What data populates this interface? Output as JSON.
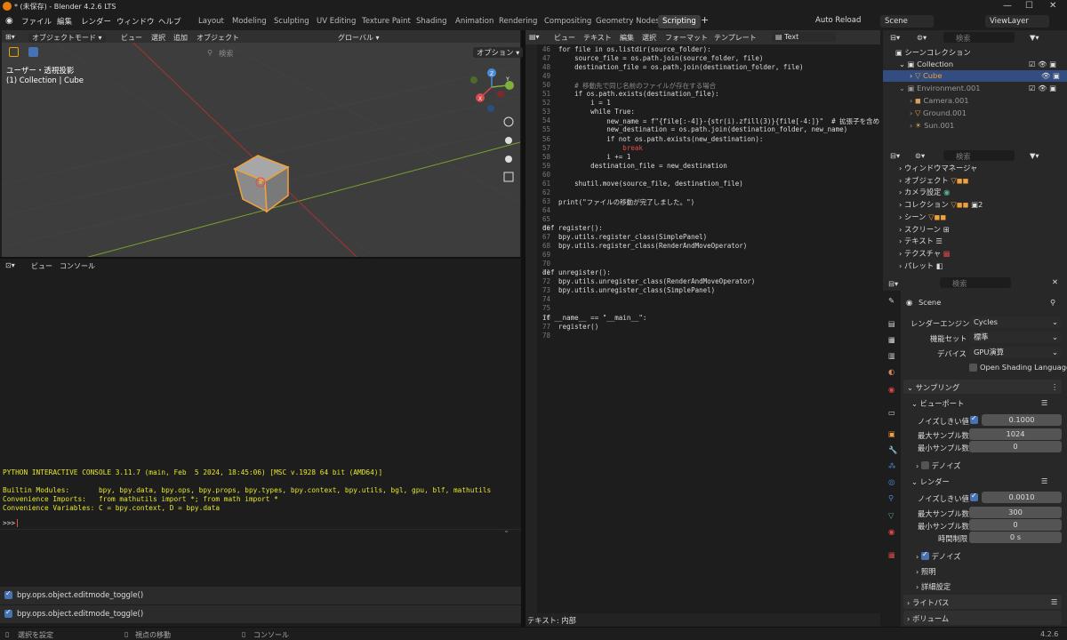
{
  "window": {
    "title": "* (未保存) - Blender 4.2.6 LTS"
  },
  "menus": [
    "ファイル",
    "編集",
    "レンダー",
    "ウィンドウ",
    "ヘルプ"
  ],
  "workspaces": [
    "Layout",
    "Modeling",
    "Sculpting",
    "UV Editing",
    "Texture Paint",
    "Shading",
    "Animation",
    "Rendering",
    "Compositing",
    "Geometry Nodes",
    "Scripting"
  ],
  "active_workspace": "Scripting",
  "top_right": {
    "auto_reload": "Auto Reload",
    "scene": "Scene",
    "view_layer": "ViewLayer"
  },
  "viewport": {
    "mode": "オブジェクトモード",
    "menu": [
      "ビュー",
      "選択",
      "追加",
      "オブジェクト"
    ],
    "orientation": "グローバル",
    "search_placeholder": "検索",
    "options": "オプション",
    "overlay_title": "ユーザー・透視投影",
    "overlay_sub": "(1) Collection | Cube",
    "gizmo": {
      "x": "X",
      "y": "Y",
      "z": "Z"
    }
  },
  "console": {
    "menu": [
      "ビュー",
      "コンソール"
    ],
    "banner": "PYTHON INTERACTIVE CONSOLE 3.11.7 (main, Feb  5 2024, 18:45:06) [MSC v.1928 64 bit (AMD64)]",
    "modules": "Builtin Modules:       bpy, bpy.data, bpy.ops, bpy.props, bpy.types, bpy.context, bpy.utils, bgl, gpu, blf, mathutils",
    "imports": "Convenience Imports:   from mathutils import *; from math import *",
    "variables": "Convenience Variables: C = bpy.context, D = bpy.data",
    "prompt": ">>> ",
    "history": [
      "bpy.ops.object.editmode_toggle()",
      "bpy.ops.object.editmode_toggle()"
    ]
  },
  "editor": {
    "menu": [
      "ビュー",
      "テキスト",
      "編集",
      "選択",
      "フォーマット",
      "テンプレート"
    ],
    "text_name": "Text",
    "footer": "テキスト: 内部",
    "lines": [
      {
        "n": "46",
        "t": "    for file in os.listdir(source_folder):"
      },
      {
        "n": "47",
        "t": "        source_file = os.path.join(source_folder, file)"
      },
      {
        "n": "48",
        "t": "        destination_file = os.path.join(destination_folder, file)"
      },
      {
        "n": "49",
        "t": ""
      },
      {
        "n": "50",
        "t": "        # 移動先で同じ名前のファイルが存在する場合"
      },
      {
        "n": "51",
        "t": "        if os.path.exists(destination_file):"
      },
      {
        "n": "52",
        "t": "            i = 1"
      },
      {
        "n": "53",
        "t": "            while True:"
      },
      {
        "n": "54",
        "t": "                new_name = f\"{file[:-4]}-{str(i).zfill(3)}{file[-4:]}\"  # 拡張子を含め"
      },
      {
        "n": "55",
        "t": "                new_destination = os.path.join(destination_folder, new_name)"
      },
      {
        "n": "56",
        "t": "                if not os.path.exists(new_destination):"
      },
      {
        "n": "57",
        "t": "                    break"
      },
      {
        "n": "58",
        "t": "                i += 1"
      },
      {
        "n": "59",
        "t": "            destination_file = new_destination"
      },
      {
        "n": "60",
        "t": ""
      },
      {
        "n": "61",
        "t": "        shutil.move(source_file, destination_file)"
      },
      {
        "n": "62",
        "t": ""
      },
      {
        "n": "63",
        "t": "    print(\"ファイルの移動が完了しました。\")"
      },
      {
        "n": "64",
        "t": ""
      },
      {
        "n": "65",
        "t": ""
      },
      {
        "n": "66",
        "t": "def register():"
      },
      {
        "n": "67",
        "t": "    bpy.utils.register_class(SimplePanel)"
      },
      {
        "n": "68",
        "t": "    bpy.utils.register_class(RenderAndMoveOperator)"
      },
      {
        "n": "69",
        "t": ""
      },
      {
        "n": "70",
        "t": ""
      },
      {
        "n": "71",
        "t": "def unregister():"
      },
      {
        "n": "72",
        "t": "    bpy.utils.unregister_class(RenderAndMoveOperator)"
      },
      {
        "n": "73",
        "t": "    bpy.utils.unregister_class(SimplePanel)"
      },
      {
        "n": "74",
        "t": ""
      },
      {
        "n": "75",
        "t": ""
      },
      {
        "n": "76",
        "t": "if __name__ == \"__main__\":"
      },
      {
        "n": "77",
        "t": "    register()"
      },
      {
        "n": "78",
        "t": ""
      }
    ]
  },
  "outliner": {
    "search_placeholder": "検索",
    "scene_collection": "シーンコレクション",
    "items": [
      "Collection",
      "Cube",
      "Environment.001",
      "Camera.001",
      "Ground.001",
      "Sun.001"
    ]
  },
  "datablocks": {
    "search_placeholder": "検索",
    "items": [
      "ウィンドウマネージャ",
      "オブジェクト",
      "カメラ設定",
      "コレクション",
      "シーン",
      "スクリーン",
      "テキスト",
      "テクスチャ",
      "パレット"
    ],
    "collection_count": "2"
  },
  "properties": {
    "search_placeholder": "検索",
    "scene": "Scene",
    "render_engine_label": "レンダーエンジン",
    "render_engine": "Cycles",
    "feature_set_label": "機能セット",
    "feature_set": "標準",
    "device_label": "デバイス",
    "device": "GPU演算",
    "osl": "Open Shading Language",
    "sampling": "サンプリング",
    "viewport": "ビューポート",
    "noise_threshold_label": "ノイズしきい値",
    "vp_noise": "0.1000",
    "max_samples_label": "最大サンプル数",
    "vp_max": "1024",
    "min_samples_label": "最小サンプル数",
    "vp_min": "0",
    "denoise": "デノイズ",
    "render": "レンダー",
    "r_noise": "0.0010",
    "r_max": "300",
    "r_min": "0",
    "time_limit_label": "時間制限",
    "r_time": "0 s",
    "denoise2": "デノイズ",
    "lights": "照明",
    "advanced": "詳細設定",
    "light_paths": "ライトパス",
    "volumes": "ボリューム"
  },
  "status": {
    "select": "選択を設定",
    "move_view": "視点の移動",
    "console": "コンソール",
    "version": "4.2.6"
  }
}
